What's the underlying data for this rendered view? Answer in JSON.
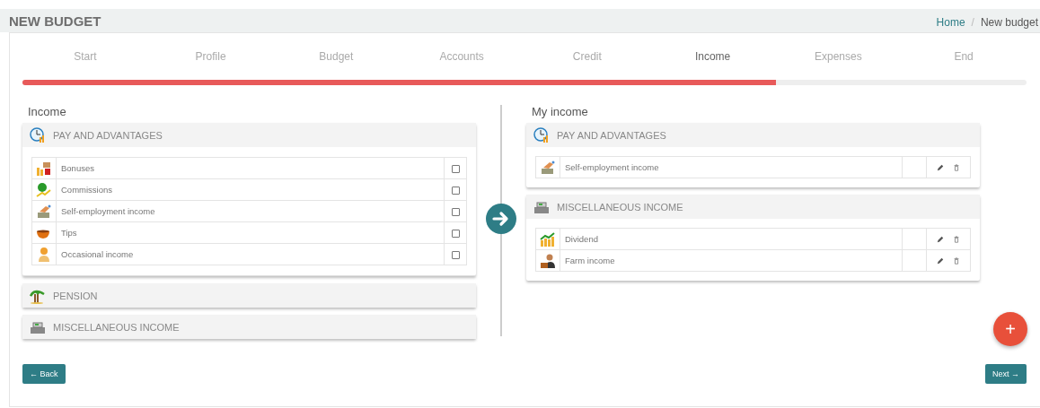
{
  "header": {
    "title": "NEW BUDGET",
    "breadcrumb_link": "Home",
    "breadcrumb_separator": "/",
    "breadcrumb_current": "New budget"
  },
  "steps": [
    {
      "label": "Start",
      "selected": false
    },
    {
      "label": "Profile",
      "selected": false
    },
    {
      "label": "Budget",
      "selected": false
    },
    {
      "label": "Accounts",
      "selected": false
    },
    {
      "label": "Credit",
      "selected": false
    },
    {
      "label": "Income",
      "selected": true
    },
    {
      "label": "Expenses",
      "selected": false
    },
    {
      "label": "End",
      "selected": false
    }
  ],
  "progress": {
    "level": 0.75
  },
  "available": {
    "title": "Income",
    "categories": [
      {
        "name": "PAY AND ADVANTAGES",
        "expanded": true,
        "items": [
          {
            "label": "Bonuses",
            "checked": false
          },
          {
            "label": "Commissions",
            "checked": false
          },
          {
            "label": "Self-employment income",
            "checked": false
          },
          {
            "label": "Tips",
            "checked": false
          },
          {
            "label": "Occasional income",
            "checked": false
          }
        ]
      },
      {
        "name": "PENSION",
        "expanded": false
      },
      {
        "name": "MISCELLANEOUS INCOME",
        "expanded": false
      }
    ]
  },
  "mine": {
    "title": "My income",
    "categories": [
      {
        "name": "PAY AND ADVANTAGES",
        "items": [
          {
            "label": "Self-employment income"
          }
        ]
      },
      {
        "name": "MISCELLANEOUS INCOME",
        "items": [
          {
            "label": "Dividend"
          },
          {
            "label": "Farm income"
          }
        ]
      }
    ]
  },
  "buttons": {
    "back": "← Back",
    "next": "Next →",
    "add": "+"
  }
}
